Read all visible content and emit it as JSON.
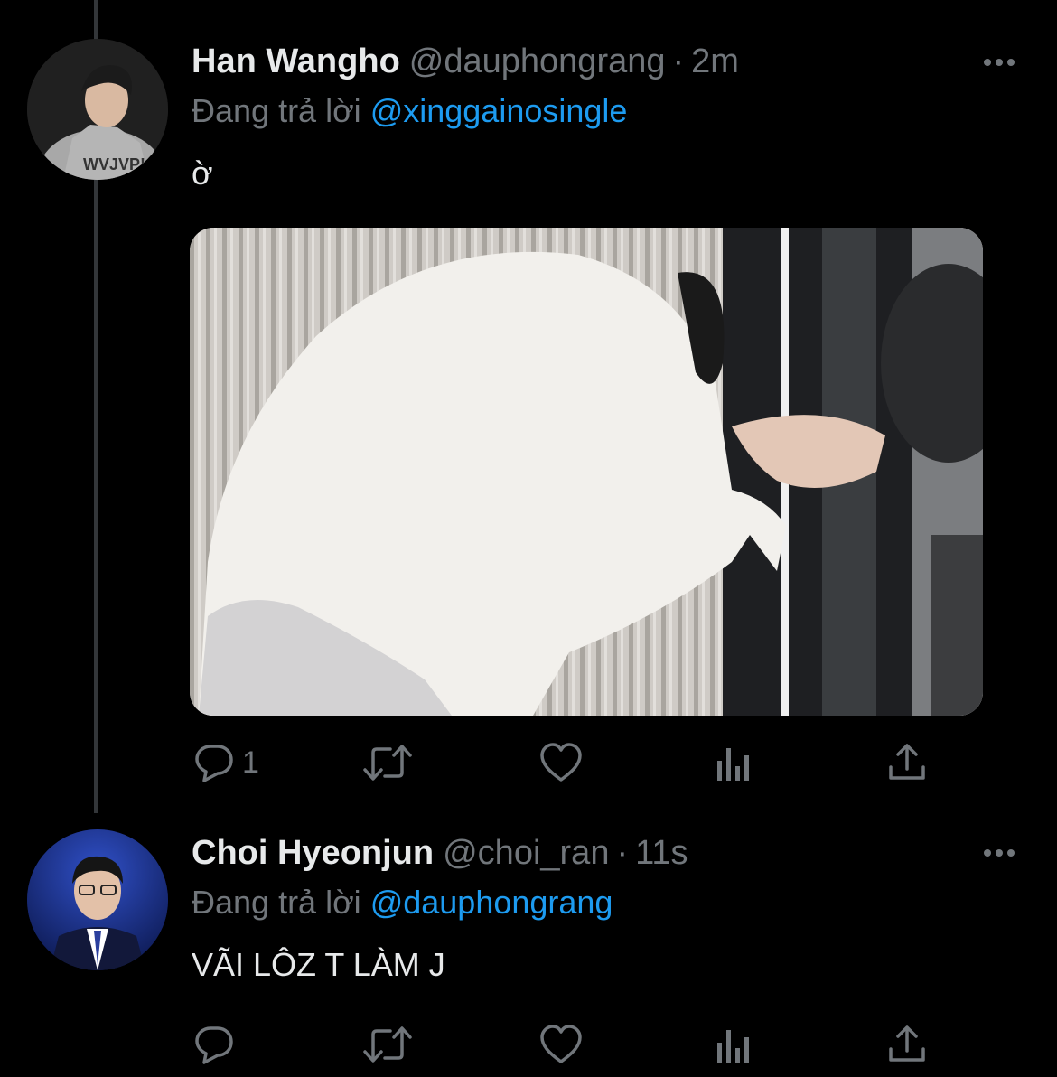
{
  "tweets": [
    {
      "display_name": "Han Wangho",
      "handle": "@dauphongrang",
      "separator": "·",
      "time": "2m",
      "replying_label": "Đang trả lời",
      "replying_to": "@xinggainosingle",
      "text": "ờ",
      "avatar_icon": "avatar-photo",
      "has_media": true,
      "actions": {
        "reply_count": "1",
        "retweet_count": "",
        "like_count": ""
      }
    },
    {
      "display_name": "Choi Hyeonjun",
      "handle": "@choi_ran",
      "separator": "·",
      "time": "11s",
      "replying_label": "Đang trả lời",
      "replying_to": "@dauphongrang",
      "text": "VÃI LÔZ T LÀM J",
      "avatar_icon": "avatar-photo",
      "has_media": false,
      "actions": {
        "reply_count": "",
        "retweet_count": "",
        "like_count": ""
      }
    }
  ],
  "icons": {
    "reply": "reply-icon",
    "retweet": "retweet-icon",
    "like": "heart-icon",
    "analytics": "analytics-icon",
    "share": "share-icon",
    "more": "more-options-icon"
  },
  "colors": {
    "background": "#000000",
    "text": "#e7e9ea",
    "secondary": "#71767b",
    "accent": "#1d9bf0",
    "thread_line": "#333639"
  }
}
